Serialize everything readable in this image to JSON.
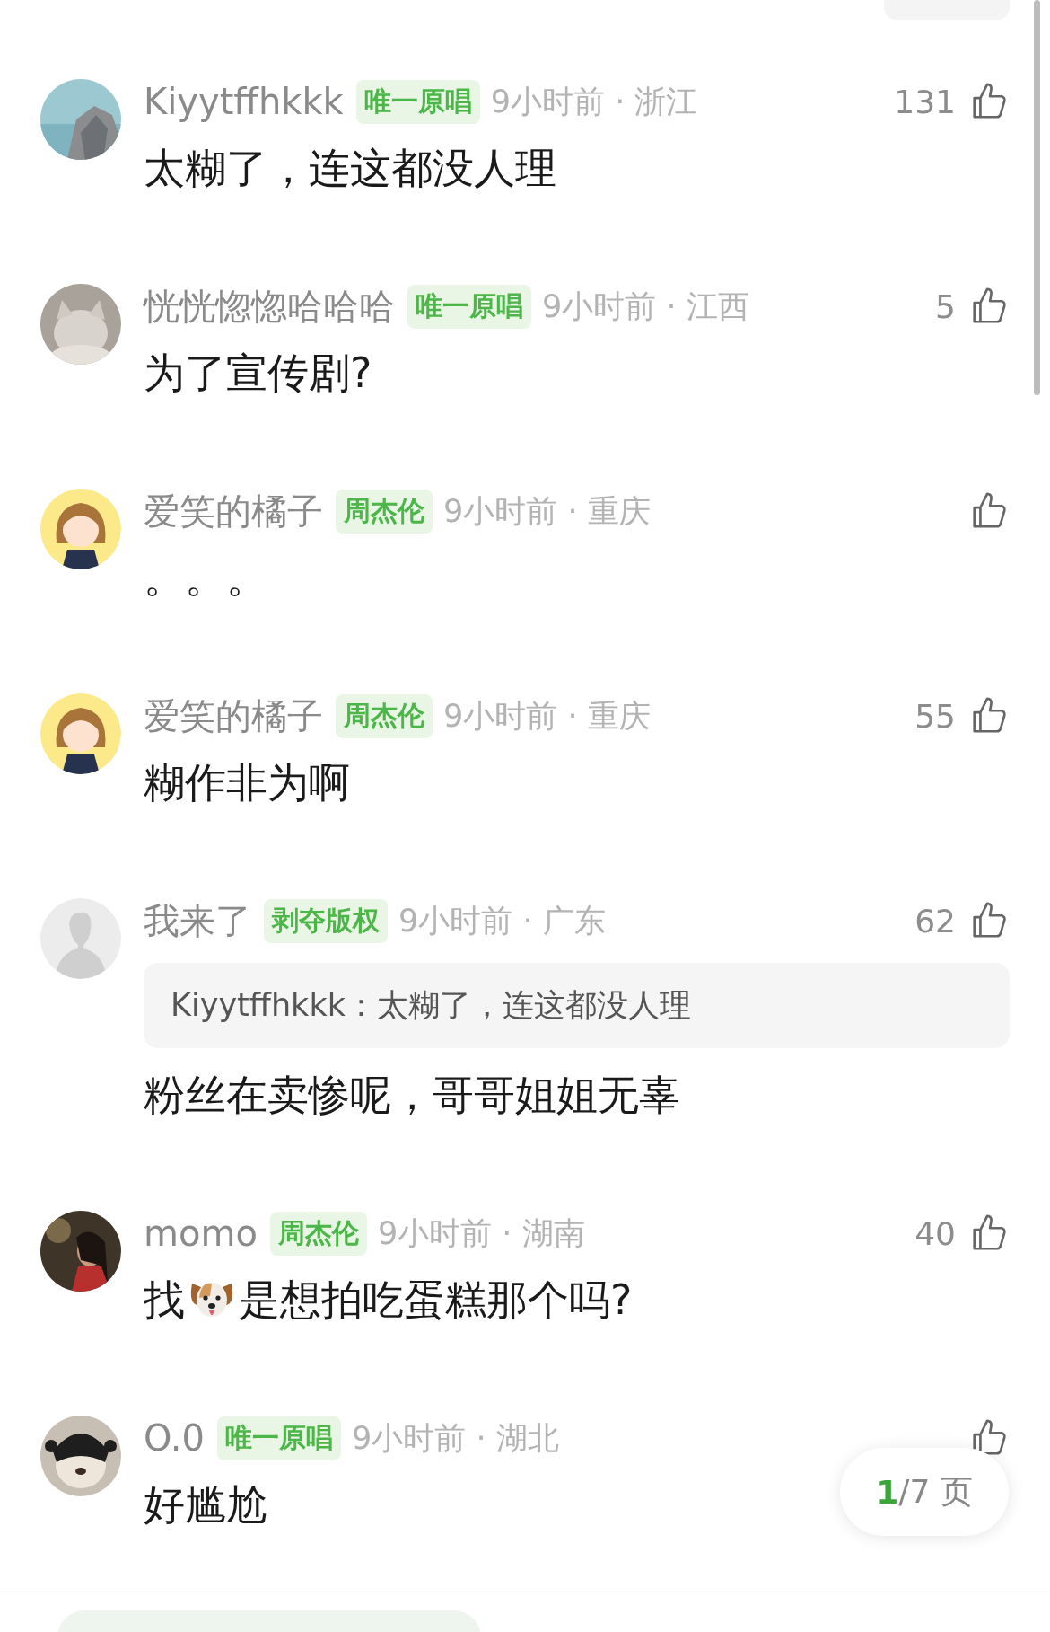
{
  "comments": [
    {
      "name": "Kiyytffhkkk",
      "badge": "唯一原唱",
      "meta": "9小时前 · 浙江",
      "likes": "131",
      "content": [
        {
          "kind": "text",
          "text": "太糊了，连这都没人理"
        }
      ]
    },
    {
      "name": "恍恍惚惚哈哈哈",
      "badge": "唯一原唱",
      "meta": "9小时前 · 江西",
      "likes": "5",
      "content": [
        {
          "kind": "text",
          "text": "为了宣传剧?"
        }
      ]
    },
    {
      "avatar": {
        "kind": "cartoon"
      },
      "name": "爱笑的橘子",
      "badge": "周杰伦",
      "meta": "9小时前 · 重庆",
      "content": [
        {
          "kind": "text",
          "text": "。。。"
        }
      ]
    },
    {
      "avatar": {
        "kind": "cartoon"
      },
      "name": "爱笑的橘子",
      "badge": "周杰伦",
      "meta": "9小时前 · 重庆",
      "likes": "55",
      "content": [
        {
          "kind": "text",
          "text": "糊作非为啊"
        }
      ]
    },
    {
      "avatar": {
        "kind": "default"
      },
      "name": "我来了",
      "badge": "剥夺版权",
      "meta": "9小时前 · 广东",
      "likes": "62",
      "quote": "Kiyytffhkkk：太糊了，连这都没人理",
      "content": [
        {
          "kind": "text",
          "text": "粉丝在卖惨呢，哥哥姐姐无辜"
        }
      ]
    },
    {
      "name": "momo",
      "badge": "周杰伦",
      "meta": "9小时前 · 湖南",
      "likes": "40",
      "content": [
        {
          "kind": "text",
          "text": "找"
        },
        {
          "kind": "emoji"
        },
        {
          "kind": "text",
          "text": "是想拍吃蛋糕那个吗?"
        }
      ]
    },
    {
      "name": "O.0",
      "badge": "唯一原唱",
      "meta": "9小时前 · 湖北",
      "content": [
        {
          "kind": "text",
          "text": "好尴尬"
        }
      ]
    }
  ],
  "pager": {
    "current": "1",
    "rest": "/7 页"
  }
}
